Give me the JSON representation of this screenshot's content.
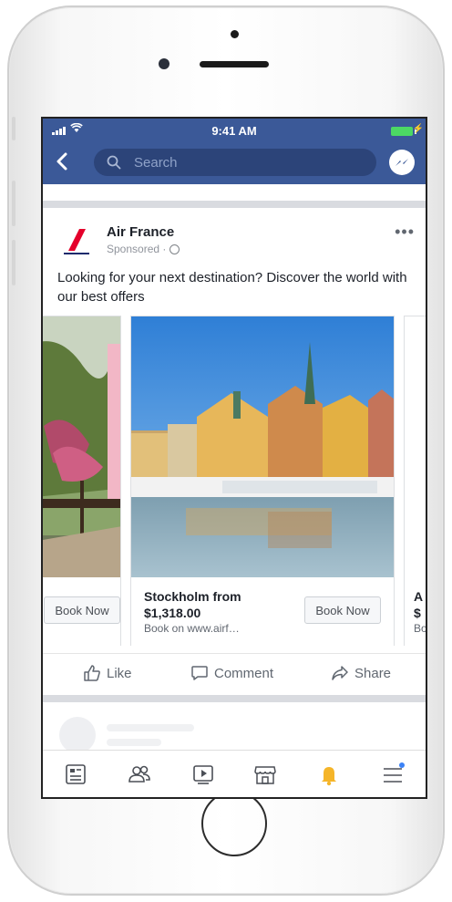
{
  "status_bar": {
    "time": "9:41 AM"
  },
  "nav": {
    "search_placeholder": "Search"
  },
  "post": {
    "page_name": "Air France",
    "sponsored_label": "Sponsored ·",
    "text": "Looking for your next destination? Discover the world with our best offers",
    "cards": [
      {
        "button": "Book Now"
      },
      {
        "title_line1": "Stockholm from",
        "title_line2": "$1,318.00",
        "subtitle": "Book on www.airf…",
        "button": "Book Now"
      },
      {
        "title_line1": "A",
        "title_line2": "$",
        "subtitle": "Bo"
      }
    ],
    "actions": {
      "like": "Like",
      "comment": "Comment",
      "share": "Share"
    }
  },
  "colors": {
    "facebook_blue": "#3b5998",
    "airfrance_red": "#e4002b",
    "notification_yellow": "#f5b529"
  },
  "icons": [
    "back-icon",
    "search-icon",
    "messenger-icon",
    "more-icon",
    "globe-icon",
    "like-icon",
    "comment-icon",
    "share-icon",
    "news-feed-icon",
    "friends-icon",
    "watch-icon",
    "marketplace-icon",
    "notifications-icon",
    "menu-icon"
  ]
}
